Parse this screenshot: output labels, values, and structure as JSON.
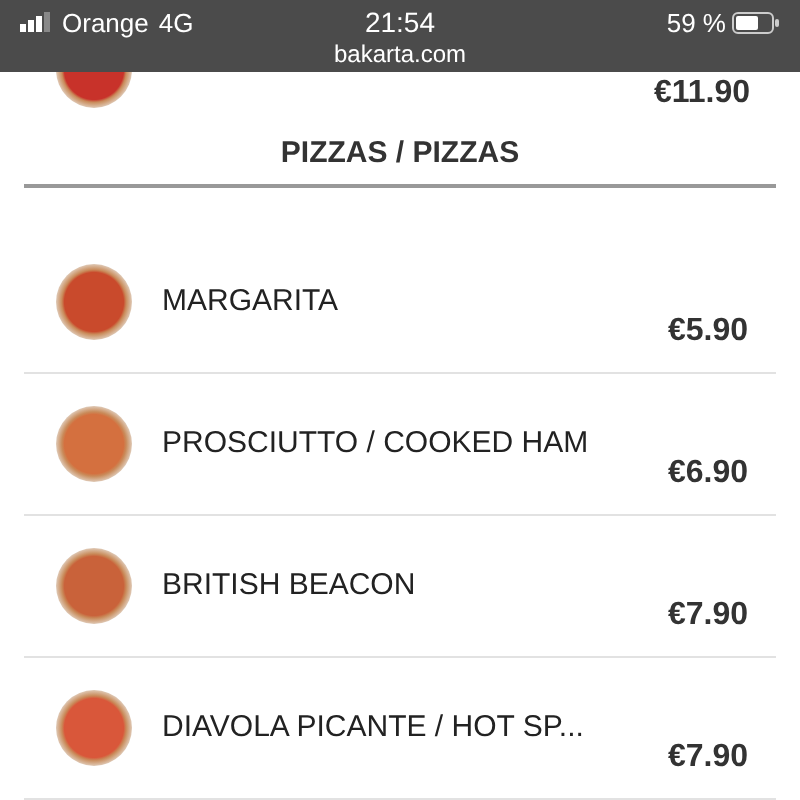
{
  "status_bar": {
    "carrier": "Orange",
    "network": "4G",
    "time": "21:54",
    "battery": "59 %",
    "url": "bakarta.com"
  },
  "partial_item": {
    "price": "€11.90"
  },
  "section": {
    "title": "PIZZAS / PIZZAS"
  },
  "items": [
    {
      "name": "MARGARITA",
      "price": "€5.90"
    },
    {
      "name": "PROSCIUTTO / COOKED HAM",
      "price": "€6.90"
    },
    {
      "name": "BRITISH BEACON",
      "price": "€7.90"
    },
    {
      "name": "DIAVOLA PICANTE / HOT SP...",
      "price": "€7.90"
    }
  ]
}
